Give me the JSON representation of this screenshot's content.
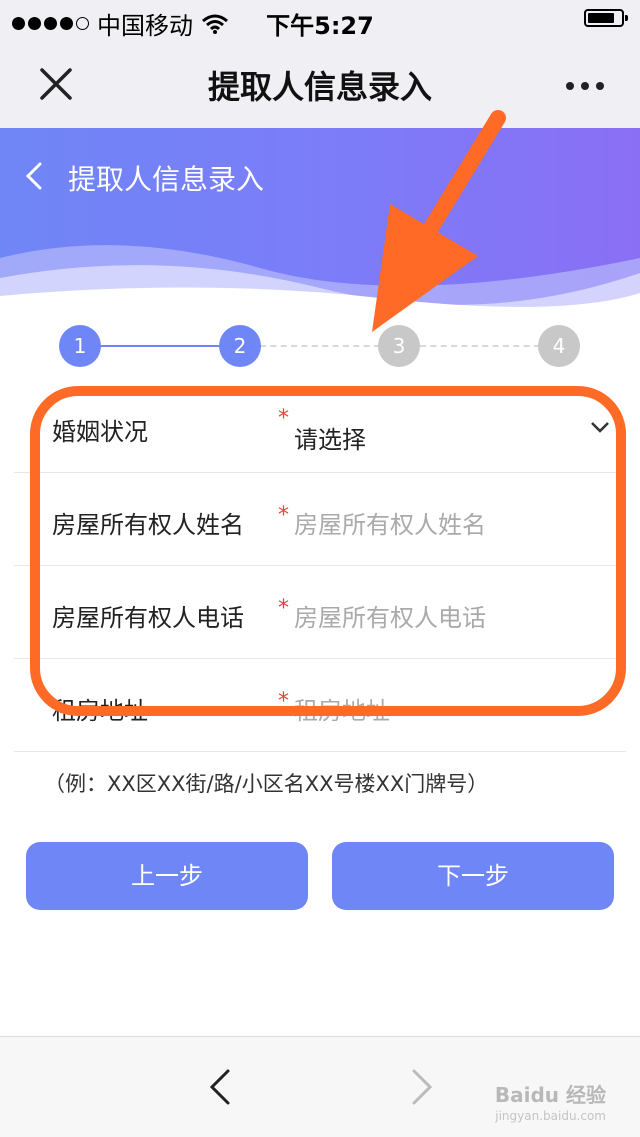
{
  "statusbar": {
    "carrier": "中国移动",
    "time": "下午5:27"
  },
  "navbar": {
    "title": "提取人信息录入"
  },
  "hero": {
    "title": "提取人信息录入"
  },
  "steps": [
    {
      "label": "1",
      "state": "done"
    },
    {
      "label": "2",
      "state": "current"
    },
    {
      "label": "3",
      "state": "todo"
    },
    {
      "label": "4",
      "state": "todo"
    }
  ],
  "form": {
    "marital": {
      "label": "婚姻状况",
      "required": "*",
      "value": "请选择"
    },
    "owner_name": {
      "label": "房屋所有权人姓名",
      "required": "*",
      "placeholder": "房屋所有权人姓名"
    },
    "owner_phone": {
      "label": "房屋所有权人电话",
      "required": "*",
      "placeholder": "房屋所有权人电话"
    },
    "rent_address": {
      "label": "租房地址",
      "required": "*",
      "placeholder": "租房地址"
    }
  },
  "hint": "（例：XX区XX街/路/小区名XX号楼XX门牌号）",
  "buttons": {
    "prev": "上一步",
    "next": "下一步"
  },
  "watermark": {
    "brand": "Baidu 经验",
    "url": "jingyan.baidu.com"
  },
  "colors": {
    "accent": "#6f86f6",
    "annotation": "#ff6a26",
    "required": "#e8413c"
  }
}
